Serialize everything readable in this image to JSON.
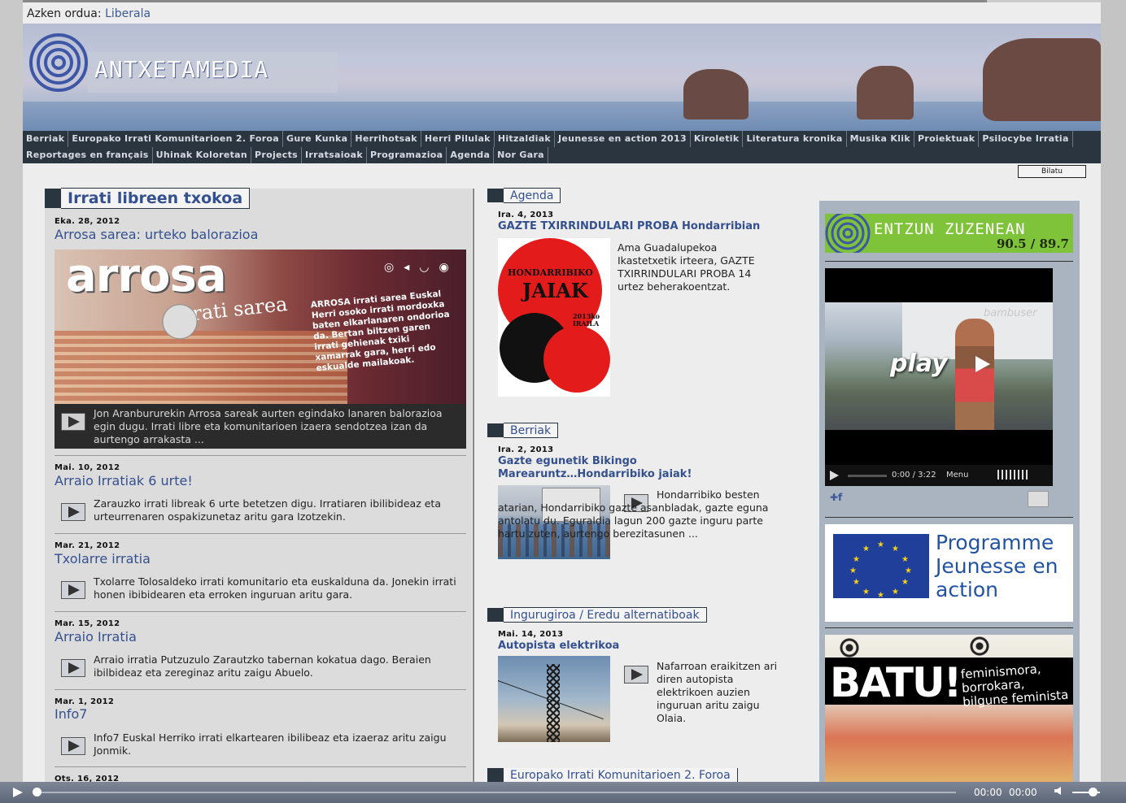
{
  "last_order": {
    "label": "Azken ordua:",
    "link": "Liberala"
  },
  "site": {
    "logo_text": "ANTXETAMEDIA"
  },
  "nav": {
    "row1": [
      "Berriak",
      "Europako Irrati Komunitarioen 2. Foroa",
      "Gure Kunka",
      "Herrihotsak",
      "Herri Pilulak",
      "Hitzaldiak",
      "Jeunesse en action 2013",
      "Kiroletik",
      "Literatura kronika",
      "Musika Klik",
      "Proiektuak",
      "Psilocybe Irratia"
    ],
    "row2": [
      "Reportages en français",
      "Uhinak Koloretan",
      "Projects",
      "Irratsaioak",
      "Programazioa",
      "Agenda",
      "Nor Gara"
    ]
  },
  "search": {
    "button": "Bilatu"
  },
  "left": {
    "box_title": "Irrati libreen txokoa",
    "items": [
      {
        "date": "Eka. 28, 2012",
        "title": "Arrosa sarea: urteko balorazioa",
        "text": "Jon Aranbururekin Arrosa sareak aurten egindako lanaren balorazioa egin dugu. Irrati libre eta komunitarioen izaera sendotzea izan da aurtengo arrakasta ..."
      },
      {
        "date": "Mai. 10, 2012",
        "title": "Arraio Irratiak 6 urte!",
        "text": "Zarauzko irrati libreak 6 urte betetzen digu. Irratiaren ibilibideaz eta urteurrenaren ospakizunetaz aritu gara Izotzekin."
      },
      {
        "date": "Mar. 21, 2012",
        "title": "Txolarre irratia",
        "text": "Txolarre Tolosaldeko irrati komunitario eta euskalduna da. Jonekin irrati honen ibibidearen eta erroken inguruan aritu gara."
      },
      {
        "date": "Mar. 15, 2012",
        "title": "Arraio Irratia",
        "text": "Arraio irratia Putzuzulo Zarautzko tabernan kokatua dago. Beraien ibilbideaz eta zereginaz aritu zaigu Abuelo."
      },
      {
        "date": "Mar. 1, 2012",
        "title": "Info7",
        "text": "Info7 Euskal Herriko irrati elkartearen ibilibeaz eta izaeraz aritu zaigu Jonmik."
      },
      {
        "date": "Ots. 16, 2012"
      }
    ],
    "arrosa_image": {
      "word": "arrosa",
      "sub": "irrati sarea",
      "desc": "ARROSA irrati sarea Euskal Herri osoko irrati mordoxka baten elkarlanaren ondorioa da. Bertan biltzen garen irrati gehienak txiki xamarrak gara, herri edo eskualde mailakoak."
    }
  },
  "middle": {
    "sections": [
      {
        "heading": "Agenda",
        "date": "Ira. 4, 2013",
        "title": "GAZTE TXIRRINDULARI PROBA Hondarribian",
        "text": "Ama Guadalupekoa Ikastetxetik irteera, GAZTE TXIRRINDULARI PROBA 14 urtez beherakoentzat."
      },
      {
        "heading": "Berriak",
        "date": "Ira. 2, 2013",
        "title": "Gazte egunetik Bikingo Marearuntz…Hondarribiko jaiak!",
        "text": "Hondarribiko besten atarian, Hondarribiko gazte asanbladak, gazte eguna antolatu du. Eguraldia lagun 200 gazte inguru parte hartu zuten, aurtengo berezitasunen ..."
      },
      {
        "heading": "Ingurugiroa / Eredu alternatiboak",
        "date": "Mai. 14, 2013",
        "title": "Autopista elektrikoa",
        "text": "Nafarroan eraikitzen ari diren autopista elektrikoen auzien inguruan aritu zaigu Olaia."
      },
      {
        "heading": "Europako Irrati Komunitarioen 2. Foroa"
      }
    ],
    "jaiak_poster": {
      "line1": "HONDARRIBIKO",
      "line2": "JAIAK",
      "line3": "2013ko",
      "line4": "IRAILA"
    }
  },
  "right": {
    "entzun": {
      "label": "ENTZUN ZUZENEAN",
      "freq": "90.5 / 89.7"
    },
    "video": {
      "play_label": "play",
      "brand": "bambuser",
      "time": "0:00 / 3:22",
      "menu": "Menu"
    },
    "programme": {
      "label": "Programme Jeunesse en action"
    },
    "batu": {
      "big": "BATU!",
      "small": "feminismora, borrokara, bilgune feminista"
    }
  },
  "player": {
    "time_current": "00:00",
    "time_total": "00:00"
  }
}
